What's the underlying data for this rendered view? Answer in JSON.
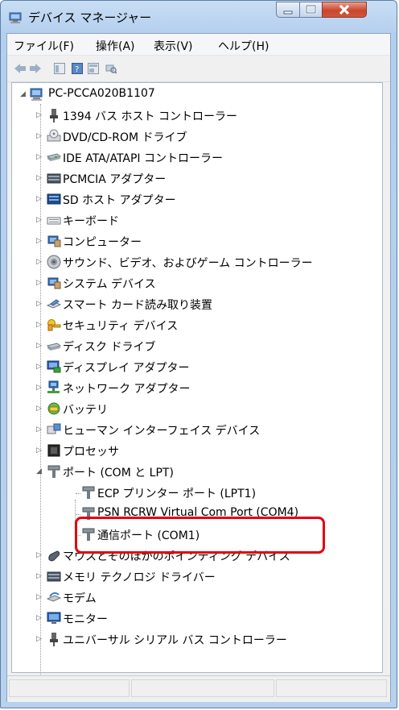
{
  "window": {
    "title": "デバイス マネージャー"
  },
  "menu": {
    "file": "ファイル(F)",
    "action": "操作(A)",
    "view": "表示(V)",
    "help": "ヘルプ(H)"
  },
  "toolbar": [
    "back-icon",
    "forward-icon",
    "console-tree-icon",
    "help-icon",
    "properties-icon",
    "scan-hardware-icon"
  ],
  "tree": {
    "root": "PC-PCCA020B1107",
    "items": [
      "1394 バス ホスト コントローラー",
      "DVD/CD-ROM ドライブ",
      "IDE ATA/ATAPI コントローラー",
      "PCMCIA アダプター",
      "SD ホスト アダプター",
      "キーボード",
      "コンピューター",
      "サウンド、ビデオ、およびゲーム コントローラー",
      "システム デバイス",
      "スマート カード読み取り装置",
      "セキュリティ デバイス",
      "ディスク ドライブ",
      "ディスプレイ アダプター",
      "ネットワーク アダプター",
      "バッテリ",
      "ヒューマン インターフェイス デバイス",
      "プロセッサ",
      "ポート (COM と LPT)"
    ],
    "ports": [
      "ECP プリンター ポート (LPT1)",
      "PSN RCRW Virtual Com Port (COM4)",
      "通信ポート (COM1)"
    ],
    "items_after": [
      "マウスとそのほかのポインティング デバイス",
      "メモリ テクノロジ ドライバー",
      "モデム",
      "モニター",
      "ユニバーサル シリアル バス コントローラー"
    ]
  },
  "colors": {
    "highlight": "#e30012",
    "selection_frame": "#e30012",
    "close_button": "#c9462c"
  }
}
